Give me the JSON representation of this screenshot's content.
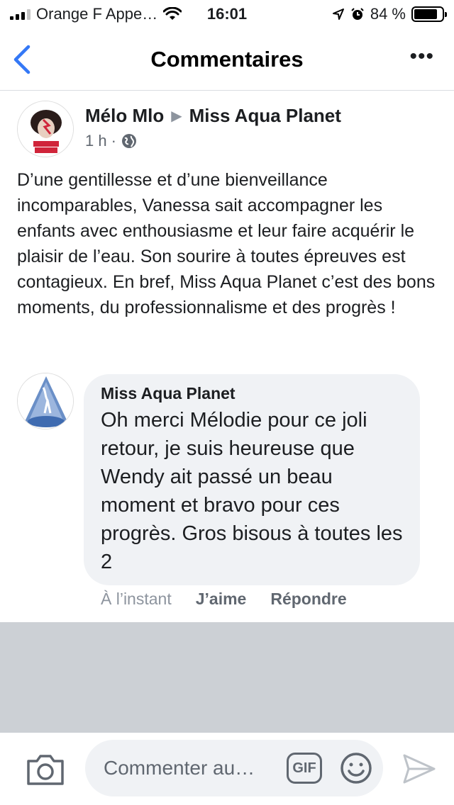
{
  "status_bar": {
    "carrier": "Orange F Appe…",
    "time": "16:01",
    "battery": "84 %",
    "battery_level": 0.84
  },
  "nav": {
    "title": "Commentaires",
    "more": "•••"
  },
  "post": {
    "author": "Mélo Mlo",
    "target": "Miss Aqua Planet",
    "time": "1 h",
    "separator": "·",
    "text": "D’une gentillesse et d’une bienveillance incomparables, Vanessa sait accompagner les enfants avec enthousiasme et leur faire acquérir le plaisir de l’eau.  Son sourire à toutes épreuves est contagieux. En bref, Miss Aqua Planet c’est des bons moments, du professionnalisme et des progrès !"
  },
  "comment": {
    "author": "Miss Aqua Planet",
    "text": "Oh merci Mélodie pour ce joli retour, je suis heureuse que Wendy ait passé un beau moment et bravo pour ces progrès. Gros bisous à toutes les 2",
    "time": "À l’instant",
    "like_label": "J’aime",
    "reply_label": "Répondre"
  },
  "composer": {
    "placeholder": "Commenter au…",
    "gif_label": "GIF"
  },
  "colors": {
    "ios_blue": "#3478f6",
    "bubble_bg": "#f0f2f5",
    "grey_area": "#ccd0d5",
    "secondary_text": "#606770"
  },
  "icons": [
    "back-chevron-icon",
    "more-icon",
    "globe-icon",
    "camera-icon",
    "emoji-icon",
    "send-icon",
    "wifi-icon",
    "location-icon",
    "alarm-icon"
  ]
}
